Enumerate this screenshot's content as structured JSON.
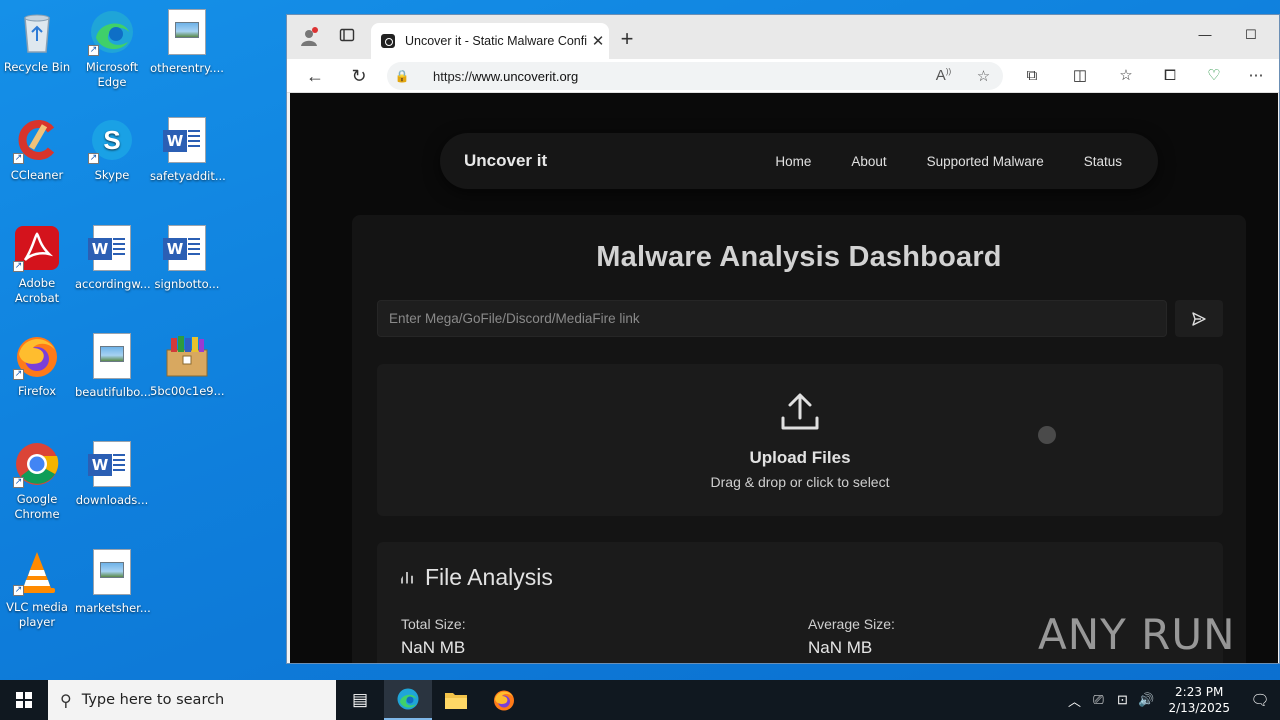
{
  "desktop": {
    "icons": [
      {
        "label": "Recycle Bin"
      },
      {
        "label": "Microsoft Edge"
      },
      {
        "label": "otherentry...."
      },
      {
        "label": "CCleaner"
      },
      {
        "label": "Skype"
      },
      {
        "label": "safetyaddit..."
      },
      {
        "label": "Adobe Acrobat"
      },
      {
        "label": "accordingw..."
      },
      {
        "label": "signbotto..."
      },
      {
        "label": "Firefox"
      },
      {
        "label": "beautifulbo..."
      },
      {
        "label": "5bc00c1e9..."
      },
      {
        "label": "Google Chrome"
      },
      {
        "label": "downloads..."
      },
      {
        "label": "VLC media player"
      },
      {
        "label": "marketsher..."
      }
    ]
  },
  "browser": {
    "tab_title": "Uncover it - Static Malware Confi",
    "url_scheme": "https://",
    "url_host": "www.uncoverit.org"
  },
  "page": {
    "brand": "Uncover it",
    "nav": [
      "Home",
      "About",
      "Supported Malware",
      "Status"
    ],
    "heading": "Malware Analysis Dashboard",
    "link_placeholder": "Enter Mega/GoFile/Discord/MediaFire link",
    "upload_title": "Upload Files",
    "upload_subtitle": "Drag & drop or click to select",
    "analysis_title": "File Analysis",
    "total_size_label": "Total Size:",
    "total_size_value": "NaN MB",
    "avg_size_label": "Average Size:",
    "avg_size_value": "NaN MB"
  },
  "watermark": "ANY RUN",
  "taskbar": {
    "search_placeholder": "Type here to search",
    "time": "2:23 PM",
    "date": "2/13/2025"
  }
}
